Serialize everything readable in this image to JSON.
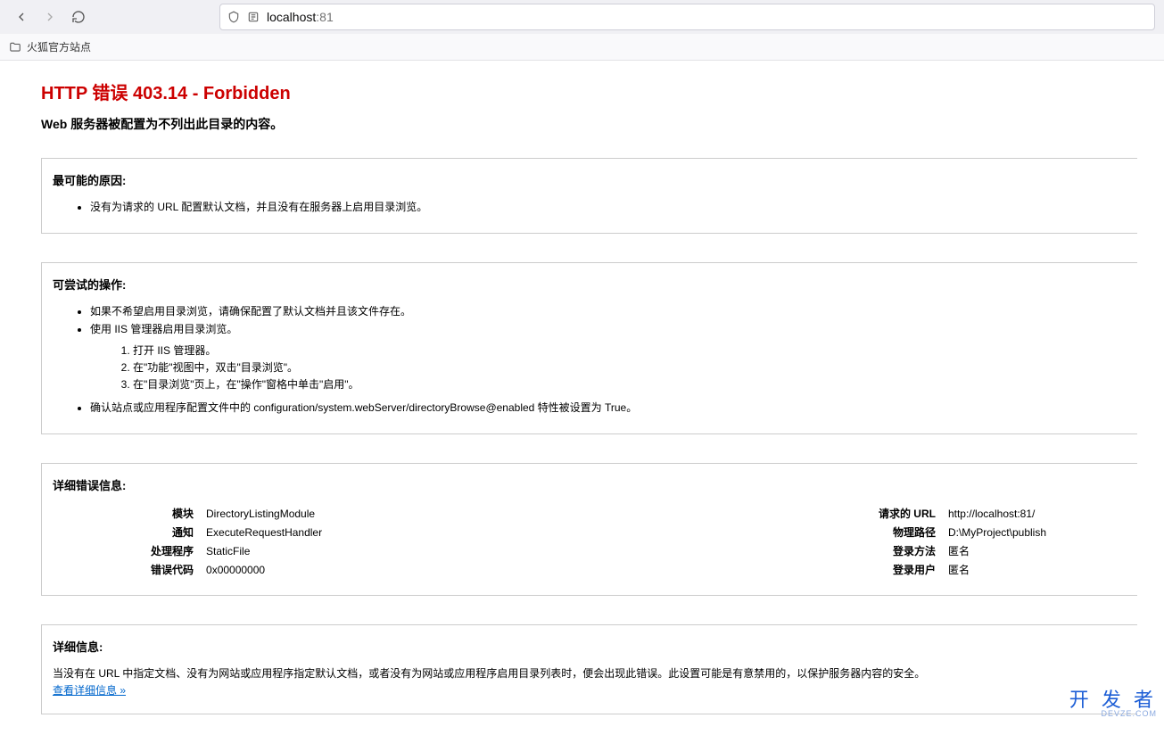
{
  "browser": {
    "url_host": "localhost",
    "url_port": ":81",
    "bookmark": "火狐官方站点"
  },
  "error": {
    "title": "HTTP 错误 403.14 - Forbidden",
    "subtitle": "Web 服务器被配置为不列出此目录的内容。"
  },
  "causes": {
    "heading": "最可能的原因:",
    "items": [
      "没有为请求的 URL 配置默认文档，并且没有在服务器上启用目录浏览。"
    ]
  },
  "try": {
    "heading": "可尝试的操作:",
    "items": [
      "如果不希望启用目录浏览，请确保配置了默认文档并且该文件存在。",
      "使用 IIS 管理器启用目录浏览。"
    ],
    "steps": [
      "打开 IIS 管理器。",
      "在\"功能\"视图中，双击\"目录浏览\"。",
      "在\"目录浏览\"页上，在\"操作\"窗格中单击\"启用\"。"
    ],
    "extra": "确认站点或应用程序配置文件中的 configuration/system.webServer/directoryBrowse@enabled 特性被设置为 True。"
  },
  "detail": {
    "heading": "详细错误信息:",
    "left": {
      "module_k": "模块",
      "module_v": "DirectoryListingModule",
      "notify_k": "通知",
      "notify_v": "ExecuteRequestHandler",
      "handler_k": "处理程序",
      "handler_v": "StaticFile",
      "code_k": "错误代码",
      "code_v": "0x00000000"
    },
    "right": {
      "url_k": "请求的 URL",
      "url_v": "http://localhost:81/",
      "path_k": "物理路径",
      "path_v": "D:\\MyProject\\publish",
      "method_k": "登录方法",
      "method_v": "匿名",
      "user_k": "登录用户",
      "user_v": "匿名"
    }
  },
  "more": {
    "heading": "详细信息:",
    "text": "当没有在 URL 中指定文档、没有为网站或应用程序指定默认文档，或者没有为网站或应用程序启用目录列表时，便会出现此错误。此设置可能是有意禁用的，以保护服务器内容的安全。",
    "link": "查看详细信息 »"
  },
  "watermark": {
    "line1": "开 发 者",
    "line2": "DEVZE.COM"
  }
}
